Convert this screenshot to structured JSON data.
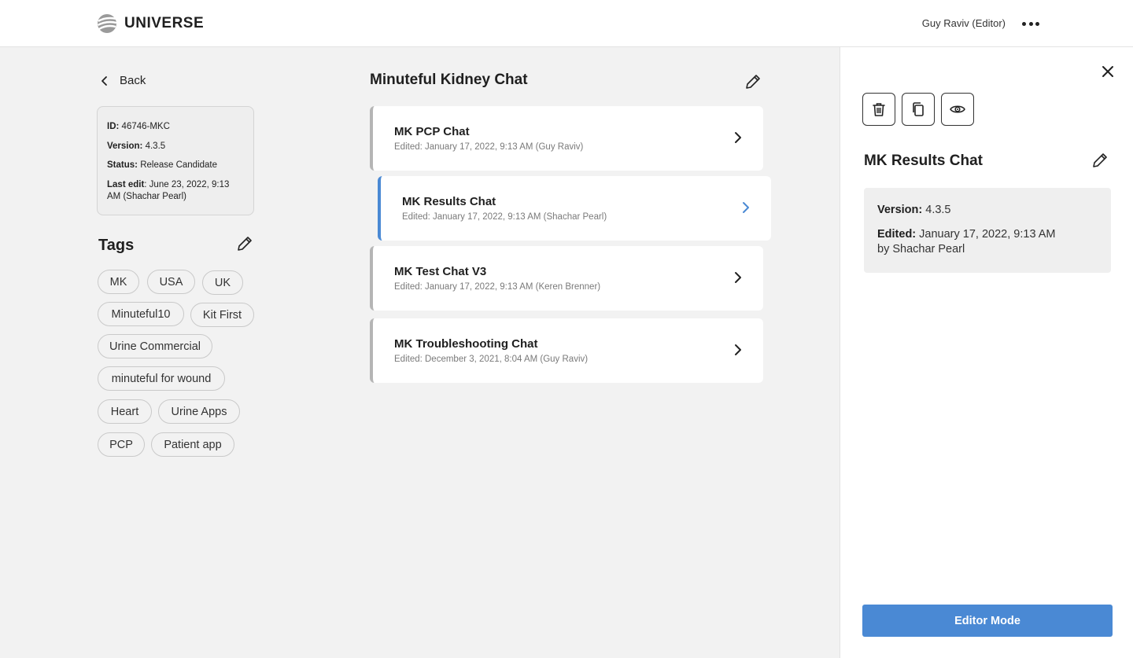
{
  "header": {
    "brand": "UNIVERSE",
    "user": "Guy Raviv (Editor)",
    "more_icon": "more-horizontal-icon"
  },
  "sidebar": {
    "back_label": "Back",
    "info": {
      "id_label": "ID:",
      "id_value": "46746-MKC",
      "version_label": "Version:",
      "version_value": "4.3.5",
      "status_label": "Status:",
      "status_value": "Release Candidate",
      "last_edit_label": "Last edit",
      "last_edit_value": ": June 23, 2022, 9:13 AM (Shachar Pearl)"
    },
    "tags_title": "Tags",
    "tags": [
      "MK",
      "USA",
      "UK",
      "Minuteful10",
      "Kit First",
      "Urine Commercial",
      "minuteful for wound",
      "Heart",
      "Urine Apps",
      "PCP",
      "Patient app"
    ]
  },
  "main": {
    "title": "Minuteful Kidney Chat",
    "chats": [
      {
        "name": "MK PCP Chat",
        "meta": "Edited: January 17, 2022, 9:13 AM (Guy Raviv)",
        "active": false
      },
      {
        "name": "MK Results Chat",
        "meta": "Edited: January 17, 2022, 9:13 AM (Shachar Pearl)",
        "active": true
      },
      {
        "name": "MK Test Chat V3",
        "meta": "Edited: January 17, 2022, 9:13 AM (Keren Brenner)",
        "active": false
      },
      {
        "name": "MK Troubleshooting Chat",
        "meta": "Edited: December 3, 2021, 8:04 AM (Guy Raviv)",
        "active": false
      }
    ]
  },
  "panel": {
    "title": "MK Results Chat",
    "version_label": "Version:",
    "version_value": "4.3.5",
    "edited_label": "Edited:",
    "edited_value": "January 17, 2022, 9:13 AM",
    "edited_by": "by Shachar Pearl",
    "editor_button": "Editor Mode",
    "tools": [
      "trash-icon",
      "copy-icon",
      "eye-icon"
    ]
  },
  "colors": {
    "accent": "#4a89d4",
    "background": "#f2f2f2",
    "card": "#ffffff",
    "inactive_border": "#b5b5b5"
  }
}
